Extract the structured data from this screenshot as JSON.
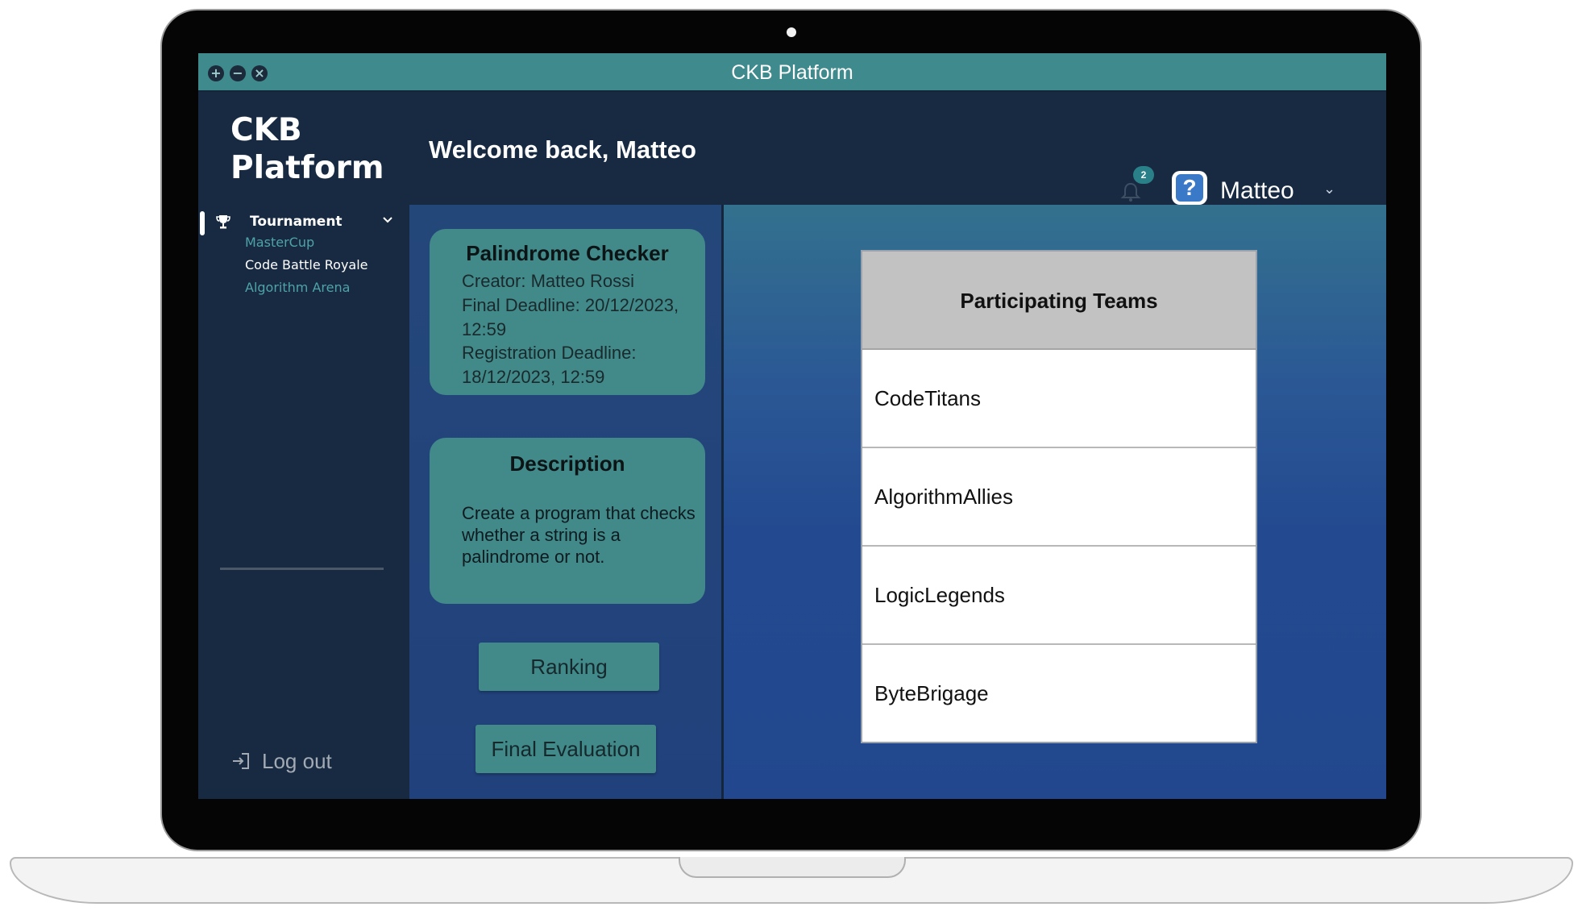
{
  "window": {
    "title": "CKB Platform"
  },
  "header": {
    "logo": "CKB Platform",
    "welcome": "Welcome back, Matteo",
    "notification_count": "2",
    "user_name": "Matteo"
  },
  "sidebar": {
    "section_label": "Tournament",
    "items": [
      {
        "label": "MasterCup"
      },
      {
        "label": "Code Battle Royale"
      },
      {
        "label": "Algorithm Arena"
      }
    ],
    "logout_label": "Log out"
  },
  "challenge": {
    "title": "Palindrome Checker",
    "creator": "Creator: Matteo Rossi",
    "final_deadline_line1": "Final Deadline: 20/12/2023,",
    "final_deadline_line2": " 12:59",
    "registration_deadline_line1": "Registration Deadline:",
    "registration_deadline_line2": "18/12/2023, 12:59"
  },
  "description": {
    "title": "Description",
    "text": "Create a program that checks whether a string is a palindrome or not."
  },
  "actions": {
    "ranking_label": "Ranking",
    "final_evaluation_label": "Final Evaluation"
  },
  "teams": {
    "header": "Participating Teams",
    "rows": [
      "CodeTitans",
      "AlgorithmAllies",
      "LogicLegends",
      "ByteBrigage"
    ]
  },
  "colors": {
    "titlebar": "#3f8a8c",
    "card": "#42898a",
    "sidebar_bg": "#172a42",
    "active_item": "#ffffff",
    "inactive_item": "#4fa3a8"
  }
}
